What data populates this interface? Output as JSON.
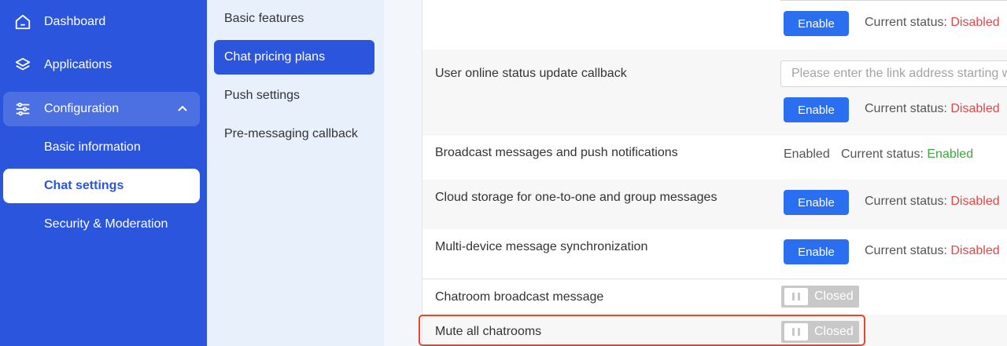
{
  "sidebar": {
    "items": [
      {
        "label": "Dashboard",
        "icon": "home-icon"
      },
      {
        "label": "Applications",
        "icon": "layers-icon"
      },
      {
        "label": "Configuration",
        "icon": "sliders-icon",
        "expanded": true
      }
    ],
    "sub_items": [
      {
        "label": "Basic information"
      },
      {
        "label": "Chat settings",
        "active": true
      },
      {
        "label": "Security & Moderation"
      }
    ]
  },
  "submenu": {
    "items": [
      {
        "label": "Basic features"
      },
      {
        "label": "Chat pricing plans",
        "active": true
      },
      {
        "label": "Push settings"
      },
      {
        "label": "Pre-messaging callback"
      }
    ]
  },
  "settings": {
    "status_prefix": "Current status: ",
    "enable_label": "Enable",
    "disabled_text": "Disabled",
    "enabled_text": "Enabled",
    "closed_text": "Closed",
    "link_placeholder": "Please enter the link address starting with",
    "rows": [
      {
        "label": "",
        "status": "Disabled"
      },
      {
        "label": "User online status update callback",
        "status": "Disabled"
      },
      {
        "label": "Broadcast messages and push notifications",
        "state_text": "Enabled",
        "status": "Enabled"
      },
      {
        "label": "Cloud storage for one-to-one and group messages",
        "status": "Disabled"
      },
      {
        "label": "Multi-device message synchronization",
        "status": "Disabled"
      },
      {
        "label": "Chatroom broadcast message",
        "toggle": "Closed"
      },
      {
        "label": "Mute all chatrooms",
        "toggle": "Closed",
        "highlighted": true
      }
    ]
  },
  "colors": {
    "sidebar_bg": "#2a55dc",
    "accent": "#2a6ff0",
    "disabled": "#e04848",
    "enabled": "#3ea63e",
    "highlight_border": "#e8452c"
  }
}
